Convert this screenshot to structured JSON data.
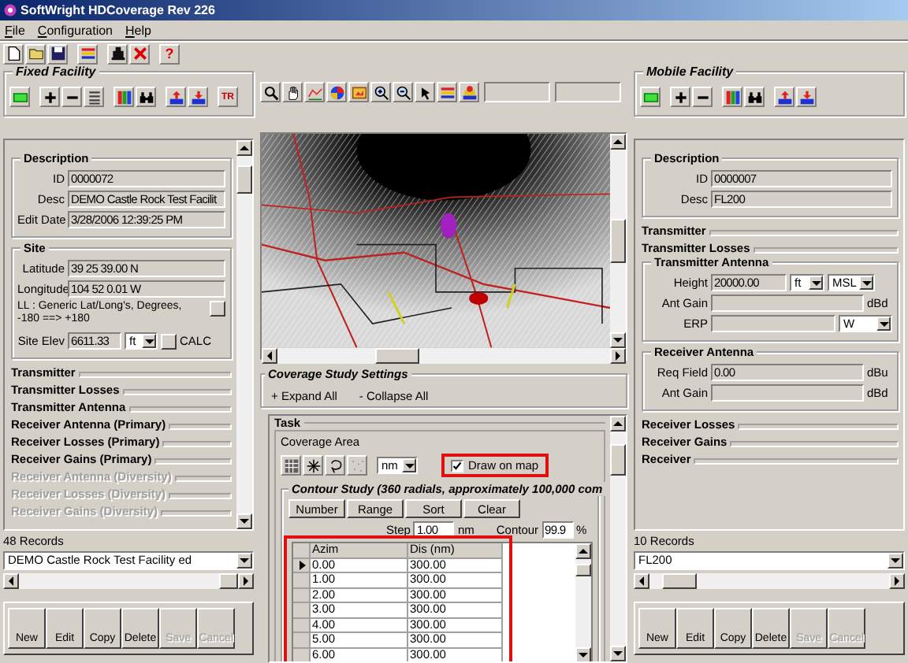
{
  "window": {
    "title": "SoftWright HDCoverage Rev 226"
  },
  "menu": [
    {
      "label": "File"
    },
    {
      "label": "Configuration"
    },
    {
      "label": "Help"
    }
  ],
  "toolbar": {
    "help": "?"
  },
  "fixed_facility": {
    "title": "Fixed Facility",
    "transfer": "TR",
    "groups": [
      {
        "title": "Description",
        "expanded": true,
        "disabled": false,
        "rows": [
          {
            "kind": "field",
            "label": "ID",
            "value": "0000072"
          },
          {
            "kind": "field",
            "label": "Desc",
            "value": "DEMO Castle Rock Test Facilit"
          },
          {
            "kind": "field",
            "label": "Edit Date",
            "value": "3/28/2006 12:39:25 PM"
          }
        ]
      },
      {
        "title": "Site",
        "expanded": true,
        "disabled": false,
        "rows": [
          {
            "kind": "field",
            "label": "Latitude",
            "value": "39 25 39.00 N"
          },
          {
            "kind": "field",
            "label": "Longitude",
            "value": "104 52 0.01 W"
          },
          {
            "kind": "note",
            "text": "LL : Generic Lat/Long's, Degrees, -180 ==> +180"
          },
          {
            "kind": "field",
            "label": "Site Elev",
            "value": "6611.33",
            "selects": [
              "ft"
            ],
            "button": true,
            "unit": "CALC"
          }
        ]
      },
      {
        "title": "Transmitter",
        "expanded": false,
        "disabled": false
      },
      {
        "title": "Transmitter Losses",
        "expanded": false,
        "disabled": false
      },
      {
        "title": "Transmitter Antenna",
        "expanded": false,
        "disabled": false
      },
      {
        "title": "Receiver Antenna (Primary)",
        "expanded": false,
        "disabled": false
      },
      {
        "title": "Receiver Losses (Primary)",
        "expanded": false,
        "disabled": false
      },
      {
        "title": "Receiver Gains (Primary)",
        "expanded": false,
        "disabled": false
      },
      {
        "title": "Receiver Antenna (Diversity)",
        "expanded": false,
        "disabled": true
      },
      {
        "title": "Receiver Losses (Diversity)",
        "expanded": false,
        "disabled": true
      },
      {
        "title": "Receiver Gains (Diversity)",
        "expanded": false,
        "disabled": true
      }
    ],
    "records": "48 Records",
    "selector": "DEMO Castle Rock Test Facility ed",
    "buttons": [
      {
        "label": "New",
        "disabled": false
      },
      {
        "label": "Edit",
        "disabled": false
      },
      {
        "label": "Copy",
        "disabled": false
      },
      {
        "label": "Delete",
        "disabled": false
      },
      {
        "label": "Save",
        "disabled": true
      },
      {
        "label": "Cancel",
        "disabled": true
      }
    ]
  },
  "coverage_study": {
    "title": "Coverage Study Settings",
    "expand": "+ Expand All",
    "collapse": "- Collapse All"
  },
  "task": {
    "title": "Task",
    "coverage_area": "Coverage Area",
    "unit": "nm",
    "draw_on_map": {
      "label": "Draw on map",
      "checked": true,
      "highlighted": true
    },
    "contour_title": "Contour Study (360 radials, approximately 100,000 com",
    "buttons": [
      "Number",
      "Range",
      "Sort",
      "Clear"
    ],
    "step": {
      "label": "Step",
      "value": "1.00",
      "unit": "nm"
    },
    "contour": {
      "label": "Contour",
      "value": "99.9",
      "unit": "%"
    },
    "table": {
      "highlighted": true,
      "columns": [
        "Azim",
        "Dis (nm)"
      ],
      "rows": [
        {
          "cells": [
            "0.00",
            "300.00"
          ],
          "selected": true
        },
        {
          "cells": [
            "1.00",
            "300.00"
          ],
          "selected": false
        },
        {
          "cells": [
            "2.00",
            "300.00"
          ],
          "selected": false
        },
        {
          "cells": [
            "3.00",
            "300.00"
          ],
          "selected": false
        },
        {
          "cells": [
            "4.00",
            "300.00"
          ],
          "selected": false
        },
        {
          "cells": [
            "5.00",
            "300.00"
          ],
          "selected": false
        },
        {
          "cells": [
            "6.00",
            "300.00"
          ],
          "selected": false
        }
      ]
    }
  },
  "mobile_facility": {
    "title": "Mobile Facility",
    "groups": [
      {
        "title": "Description",
        "expanded": true,
        "disabled": false,
        "rows": [
          {
            "kind": "field",
            "label": "ID",
            "value": "0000007"
          },
          {
            "kind": "field",
            "label": "Desc",
            "value": "FL200"
          }
        ]
      },
      {
        "title": "Transmitter",
        "expanded": false,
        "disabled": false
      },
      {
        "title": "Transmitter Losses",
        "expanded": false,
        "disabled": false
      },
      {
        "title": "Transmitter Antenna",
        "expanded": true,
        "disabled": false,
        "rows": [
          {
            "kind": "field",
            "label": "Height",
            "value": "20000.00",
            "selects": [
              "ft",
              "MSL"
            ]
          },
          {
            "kind": "field",
            "label": "Ant Gain",
            "unit": "dBd"
          },
          {
            "kind": "field",
            "label": "ERP",
            "selects": [
              "W"
            ]
          }
        ]
      },
      {
        "title": "Receiver Antenna",
        "expanded": true,
        "disabled": false,
        "rows": [
          {
            "kind": "field",
            "label": "Req Field",
            "value": "0.00",
            "unit": "dBu"
          },
          {
            "kind": "field",
            "label": "Ant Gain",
            "unit": "dBd"
          }
        ]
      },
      {
        "title": "Receiver Losses",
        "expanded": false,
        "disabled": false
      },
      {
        "title": "Receiver Gains",
        "expanded": false,
        "disabled": false
      },
      {
        "title": "Receiver",
        "expanded": false,
        "disabled": false
      }
    ],
    "records": "10 Records",
    "selector": "FL200",
    "buttons": [
      {
        "label": "New",
        "disabled": false
      },
      {
        "label": "Edit",
        "disabled": false
      },
      {
        "label": "Copy",
        "disabled": false
      },
      {
        "label": "Delete",
        "disabled": false
      },
      {
        "label": "Save",
        "disabled": true
      },
      {
        "label": "Cancel",
        "disabled": true
      }
    ]
  }
}
